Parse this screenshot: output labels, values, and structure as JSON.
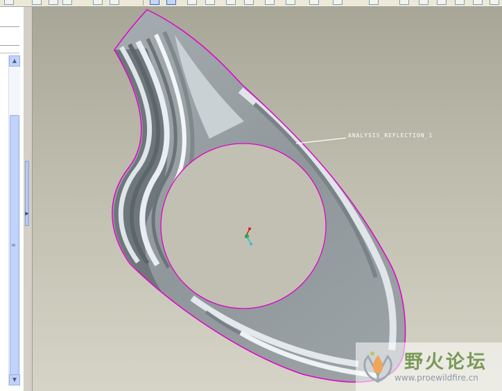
{
  "viewport": {
    "annotation_label": "ANALYSIS_REFLECTION_1"
  },
  "watermark": {
    "title": "野火论坛",
    "url": "www.proewildfire.cn"
  },
  "side_panel": {
    "scroll_up_glyph": "▲",
    "scroll_down_glyph": "▼",
    "grip_glyph": "≡",
    "splitter_left_glyph": "◀",
    "splitter_right_glyph": "▶"
  },
  "colors": {
    "edge_highlight": "#e000c8",
    "surface_base": "#939b9f",
    "surface_light": "#e2e8ec",
    "background_top": "#a7a697",
    "background_bottom": "#d6d4c6"
  },
  "icons": [
    "toolbar-button-icon",
    "scroll-up-arrow-icon",
    "scroll-down-arrow-icon",
    "csys-triad-icon",
    "forum-logo-icon"
  ]
}
